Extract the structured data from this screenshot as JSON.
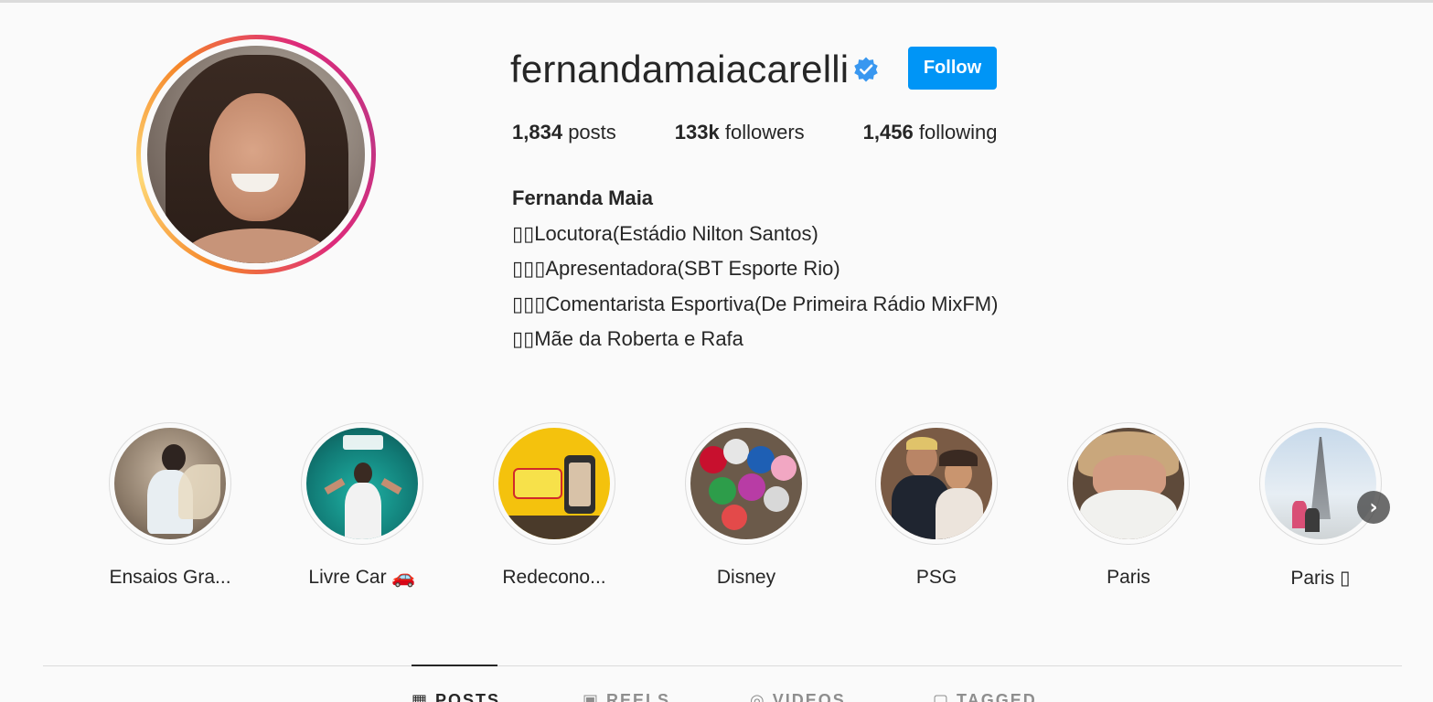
{
  "profile": {
    "username": "fernandamaiacarelli",
    "verified_icon": "verified-badge-icon",
    "follow_label": "Follow",
    "accent_color": "#0095f6",
    "stats": {
      "posts_count": "1,834",
      "posts_label": "posts",
      "followers_count": "133k",
      "followers_label": "followers",
      "following_count": "1,456",
      "following_label": "following"
    },
    "bio": {
      "name": "Fernanda Maia",
      "lines": [
        "▯▯Locutora(Estádio Nilton Santos)",
        "▯▯▯Apresentadora(SBT Esporte Rio)",
        "▯▯▯Comentarista Esportiva(De Primeira Rádio MixFM)",
        "▯▯Mãe da Roberta e Rafa"
      ]
    }
  },
  "highlights": [
    {
      "label": "Ensaios Gra..."
    },
    {
      "label": "Livre Car 🚗"
    },
    {
      "label": "Redecono..."
    },
    {
      "label": "Disney"
    },
    {
      "label": "PSG"
    },
    {
      "label": "Paris"
    },
    {
      "label": "Paris ▯"
    }
  ],
  "highlight_next_icon": "chevron-right-icon",
  "tabs": [
    {
      "label": "POSTS",
      "icon": "grid-icon"
    },
    {
      "label": "REELS",
      "icon": "reels-icon"
    },
    {
      "label": "VIDEOS",
      "icon": "play-circle-icon"
    },
    {
      "label": "TAGGED",
      "icon": "tag-icon"
    }
  ]
}
